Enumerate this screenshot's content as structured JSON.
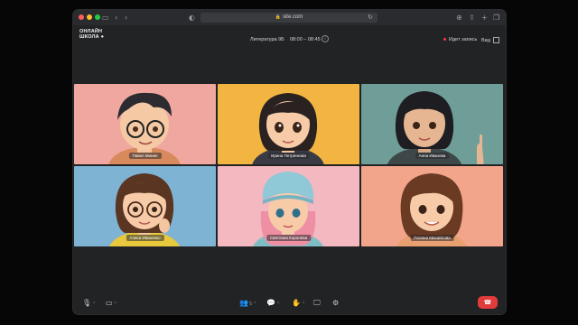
{
  "browser": {
    "url": "site.com",
    "colors": {
      "close": "#ff5f57",
      "minimize": "#febc2e",
      "maximize": "#28c840"
    }
  },
  "header": {
    "logo_line1": "ОНЛАЙН",
    "logo_line2": "ШКОЛА",
    "lesson": "Литература 9Б",
    "time": "08:00 – 08:45",
    "recording": "Идет запись",
    "view": "Вид"
  },
  "participants": [
    {
      "name": "Павел Минин",
      "bg": "#f0a7a0"
    },
    {
      "name": "Ирина Петрачкова",
      "bg": "#f2b541"
    },
    {
      "name": "Анна Иванова",
      "bg": "#6f9e98"
    },
    {
      "name": "Алиса Иваненко",
      "bg": "#7fb3d4"
    },
    {
      "name": "Светлана Королева",
      "bg": "#f3b8c0"
    },
    {
      "name": "Полина Михайлова",
      "bg": "#f2a58a"
    }
  ],
  "toolbar": {
    "participants_count": "5",
    "hangup_color": "#e23b3b"
  }
}
